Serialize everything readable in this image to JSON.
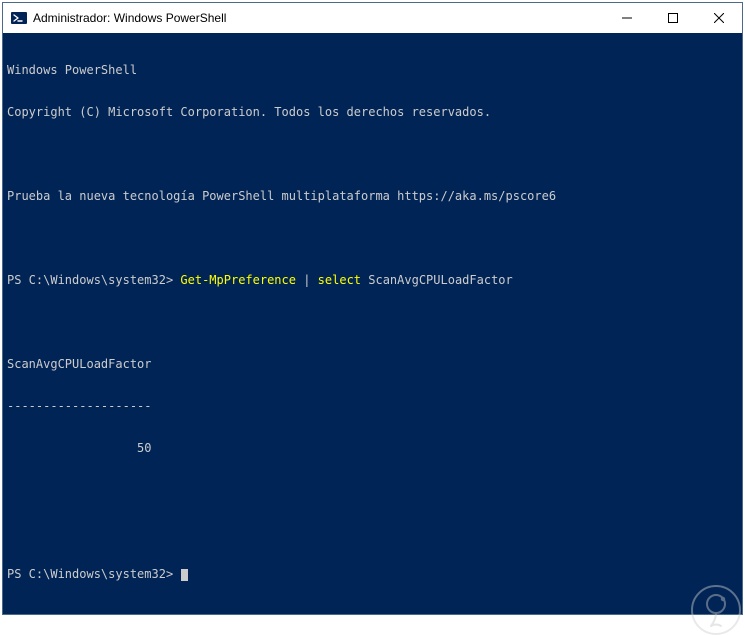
{
  "window": {
    "title": "Administrador: Windows PowerShell",
    "icon": "powershell-icon"
  },
  "terminal": {
    "header_line1": "Windows PowerShell",
    "header_line2": "Copyright (C) Microsoft Corporation. Todos los derechos reservados.",
    "tip_line": "Prueba la nueva tecnología PowerShell multiplataforma https://aka.ms/pscore6",
    "prompt_path": "PS C:\\Windows\\system32> ",
    "command_segments": {
      "cmdlet": "Get-MpPreference",
      "pipe": " | ",
      "verb": "select",
      "arg": " ScanAvgCPULoadFactor"
    },
    "output_header": "ScanAvgCPULoadFactor",
    "output_divider": "--------------------",
    "output_value": "                  50",
    "prompt2": "PS C:\\Windows\\system32> "
  }
}
